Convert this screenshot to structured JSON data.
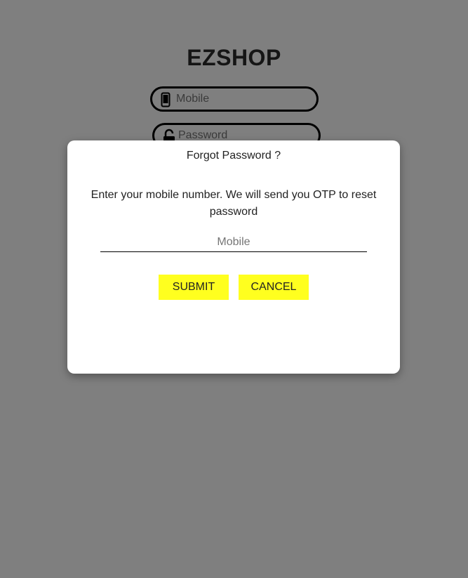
{
  "login": {
    "brand": "EZSHOP",
    "mobile_placeholder": "Mobile",
    "password_placeholder": "Password",
    "mobile_icon": "mobile-phone-icon",
    "password_icon": "unlock-icon"
  },
  "forgot_dialog": {
    "title": "Forgot Password ?",
    "message": "Enter your mobile number. We will send you OTP to reset password",
    "mobile_placeholder": "Mobile",
    "submit_label": "SUBMIT",
    "cancel_label": "CANCEL"
  },
  "colors": {
    "accent_button": "#ffff1f",
    "overlay": "rgba(0,0,0,0.5)",
    "border": "#000000"
  }
}
